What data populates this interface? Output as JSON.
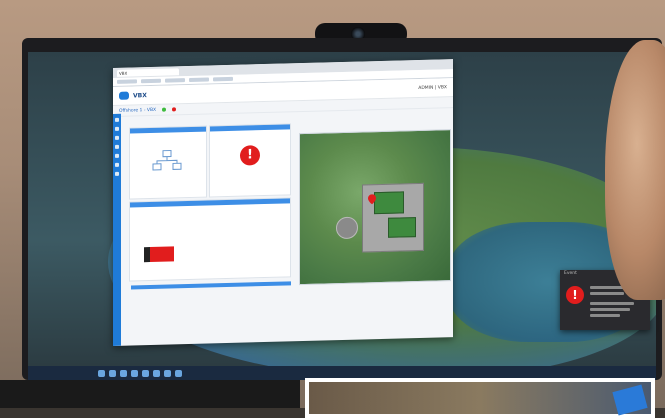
{
  "browser": {
    "tab_label": "VBX",
    "brand": "VBX",
    "header_right": "ADMIN | VBX",
    "breadcrumb": "Offshore 1 - VBX"
  },
  "notification": {
    "header": "Event"
  },
  "colors": {
    "accent": "#1f7bd8",
    "alert": "#e11d1d",
    "map_green": "#5c8a4c"
  },
  "icons": {
    "alert": "exclamation-circle-icon",
    "logo": "cloud-logo-icon"
  }
}
